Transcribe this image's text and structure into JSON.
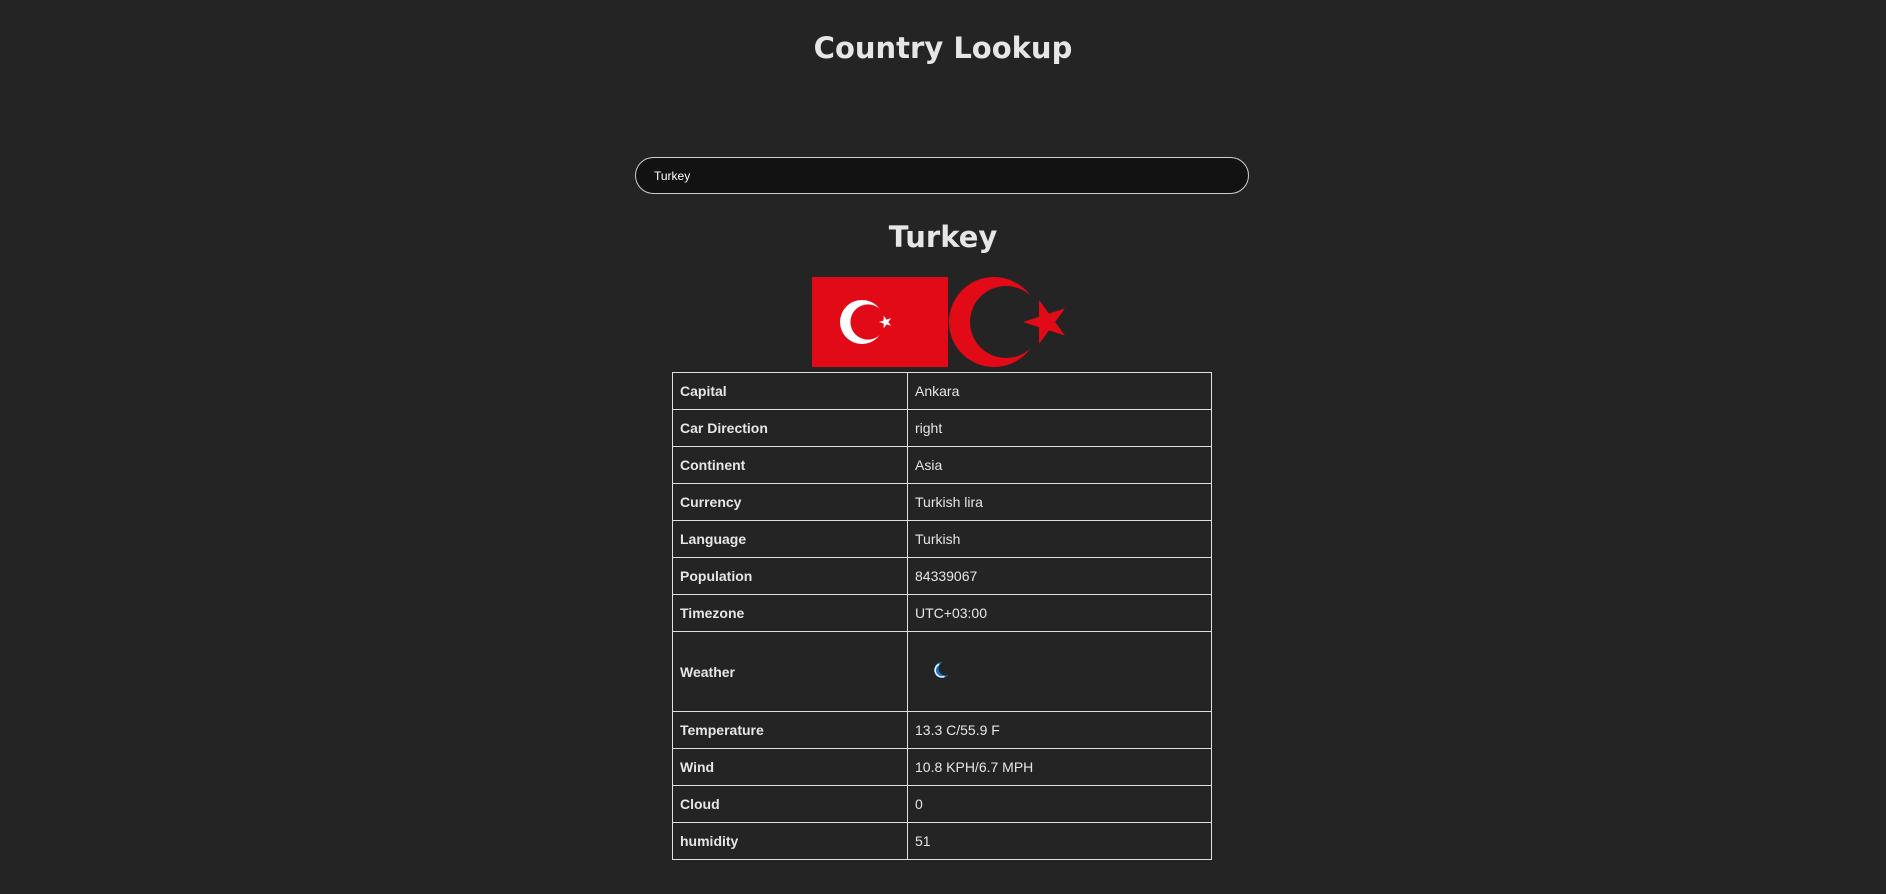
{
  "header": {
    "title": "Country Lookup"
  },
  "search": {
    "value": "Turkey",
    "placeholder": ""
  },
  "country": {
    "name": "Turkey",
    "flag_icon": "flag-of-turkey-icon",
    "emblem_icon": "crescent-star-emblem-icon",
    "flag_color": "#e30a17"
  },
  "details": [
    {
      "label": "Capital",
      "value": "Ankara"
    },
    {
      "label": "Car Direction",
      "value": "right"
    },
    {
      "label": "Continent",
      "value": "Asia"
    },
    {
      "label": "Currency",
      "value": "Turkish lira"
    },
    {
      "label": "Language",
      "value": "Turkish"
    },
    {
      "label": "Population",
      "value": "84339067"
    },
    {
      "label": "Timezone",
      "value": "UTC+03:00"
    },
    {
      "label": "Weather",
      "icon": "moon-clear-night-icon"
    },
    {
      "label": "Temperature",
      "value": "13.3 C/55.9 F"
    },
    {
      "label": "Wind",
      "value": "10.8 KPH/6.7 MPH"
    },
    {
      "label": "Cloud",
      "value": "0"
    },
    {
      "label": "humidity",
      "value": "51"
    }
  ],
  "colors": {
    "background": "#242424",
    "text": "#e6e6e6",
    "input_background": "#121212",
    "border": "#e0e0e0",
    "weather_icon": "#1e73c9"
  }
}
